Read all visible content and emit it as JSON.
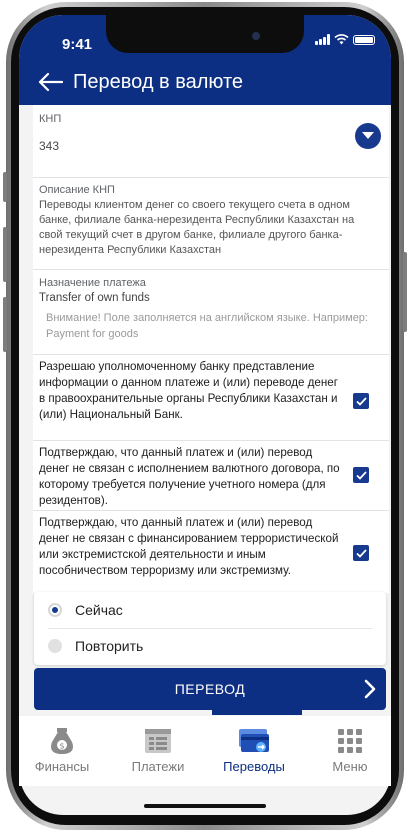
{
  "status_bar": {
    "time": "9:41"
  },
  "header": {
    "title": "Перевод в валюте"
  },
  "form": {
    "knp": {
      "label": "КНП",
      "value": "343"
    },
    "knp_description": {
      "label": "Описание КНП",
      "value": "Переводы клиентом денег со своего текущего счета в одном банке, филиале банка-нерезидента Республики Казахстан на свой текущий счет в другом банке, филиале другого банка-нерезидента Республики Казахстан"
    },
    "purpose": {
      "label": "Назначение платежа",
      "value": "Transfer of own funds",
      "hint": "Внимание! Поле заполняется на английском языке. Например: Payment for goods"
    },
    "checkboxes": [
      {
        "text": "Разрешаю уполномоченному банку представление информации о данном платеже и (или) переводе денег в правоохранительные органы Республики Казахстан и (или) Национальный Банк.",
        "checked": true
      },
      {
        "text": "Подтверждаю, что данный платеж и (или) перевод денег не связан с исполнением валютного договора, по которому требуется получение учетного номера (для резидентов).",
        "checked": true
      },
      {
        "text": "Подтверждаю, что данный платеж и (или) перевод денег не связан с финансированием террористической или экстремистской деятельности и иным пособничеством терроризму или экстремизму.",
        "checked": true
      }
    ]
  },
  "schedule": {
    "now": "Сейчас",
    "repeat": "Повторить",
    "selected": "now"
  },
  "submit_label": "ПЕРЕВОД",
  "tabs": [
    {
      "label": "Финансы",
      "icon": "money-bag-icon"
    },
    {
      "label": "Платежи",
      "icon": "payments-list-icon"
    },
    {
      "label": "Переводы",
      "icon": "transfer-card-icon"
    },
    {
      "label": "Меню",
      "icon": "menu-grid-icon"
    }
  ],
  "colors": {
    "primary": "#0c2e83",
    "background": "#f3f3f3"
  }
}
